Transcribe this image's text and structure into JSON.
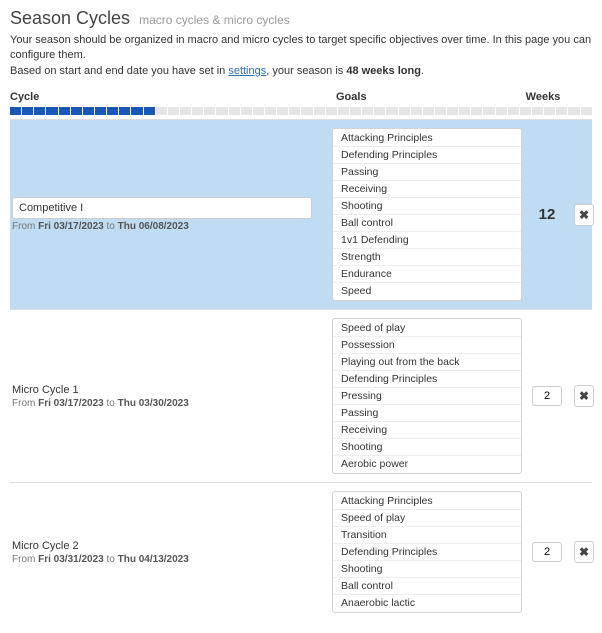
{
  "title": "Season Cycles",
  "subtitle": "macro cycles & micro cycles",
  "intro": {
    "line1": "Your season should be organized in macro and micro cycles to target specific objectives over time. In this page you can configure them.",
    "line2_a": "Based on start and end date you have set in ",
    "settings_link": "settings",
    "line2_b": ", your season is ",
    "weeks_long": "48 weeks long",
    "line2_c": "."
  },
  "columns": {
    "cycle": "Cycle",
    "goals": "Goals",
    "weeks": "Weeks"
  },
  "progress": {
    "total": 48,
    "filled": 12
  },
  "icons": {
    "delete_glyph": "✖"
  },
  "rows": [
    {
      "type": "macro",
      "highlight": true,
      "name": "Competitive I",
      "date_prefix": "From ",
      "date_from": "Fri 03/17/2023",
      "date_mid": " to ",
      "date_to": "Thu 06/08/2023",
      "weeks_display": "12",
      "goals": [
        "Attacking Principles",
        "Defending Principles",
        "Passing",
        "Receiving",
        "Shooting",
        "Ball control",
        "1v1 Defending",
        "Strength",
        "Endurance",
        "Speed"
      ]
    },
    {
      "type": "micro",
      "highlight": false,
      "name": "Micro Cycle 1",
      "date_prefix": "From ",
      "date_from": "Fri 03/17/2023",
      "date_mid": " to ",
      "date_to": "Thu 03/30/2023",
      "weeks_value": "2",
      "goals": [
        "Speed of play",
        "Possession",
        "Playing out from the back",
        "Defending Principles",
        "Pressing",
        "Passing",
        "Receiving",
        "Shooting",
        "Aerobic power"
      ]
    },
    {
      "type": "micro",
      "highlight": false,
      "name": "Micro Cycle 2",
      "date_prefix": "From ",
      "date_from": "Fri 03/31/2023",
      "date_mid": " to ",
      "date_to": "Thu 04/13/2023",
      "weeks_value": "2",
      "goals": [
        "Attacking Principles",
        "Speed of play",
        "Transition",
        "Defending Principles",
        "Shooting",
        "Ball control",
        "Anaerobic lactic"
      ]
    }
  ]
}
